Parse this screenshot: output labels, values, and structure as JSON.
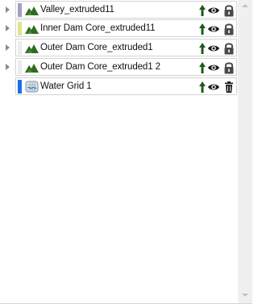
{
  "layers": [
    {
      "name": "Valley_extruded11",
      "swatch": "#a89ec0",
      "icon": "terrain-icon",
      "expandable": true,
      "action_icon": "lock-icon"
    },
    {
      "name": "Inner Dam Core_extruded11",
      "swatch": "#e1e38e",
      "icon": "terrain-icon",
      "expandable": true,
      "action_icon": "lock-icon"
    },
    {
      "name": "Outer Dam Core_extruded1",
      "swatch": "#ececec",
      "icon": "terrain-icon",
      "expandable": true,
      "action_icon": "lock-icon"
    },
    {
      "name": "Outer Dam Core_extruded1 2",
      "swatch": "#ececec",
      "icon": "terrain-icon",
      "expandable": true,
      "action_icon": "lock-icon"
    },
    {
      "name": "Water Grid 1",
      "swatch": "#1e6fe8",
      "icon": "water-grid-icon",
      "expandable": false,
      "action_icon": "trash-icon"
    }
  ],
  "colors": {
    "terrain_green": "#2f6b1f",
    "up_arrow_green": "#1d5a1d",
    "icon_dark": "#1a1a1a",
    "lock_gray": "#4a4a4a"
  }
}
